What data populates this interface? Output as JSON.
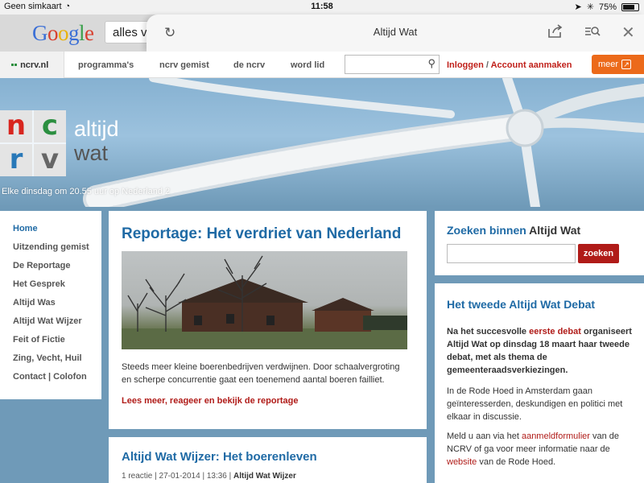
{
  "status": {
    "carrier": "Geen simkaart",
    "time": "11:58",
    "battery": "75%",
    "battery_level": 0.75
  },
  "browser": {
    "search_text": "alles v",
    "page_title": "Altijd Wat"
  },
  "nav": {
    "logo": "ncrv.nl",
    "items": [
      "programma's",
      "ncrv gemist",
      "de ncrv",
      "word lid"
    ],
    "login": "Inloggen",
    "account": "Account aanmaken",
    "meer": "meer"
  },
  "hero": {
    "logo_letters": [
      "n",
      "c",
      "r",
      "v"
    ],
    "title_line1": "altijd",
    "title_line2": "wat",
    "subtitle": "Elke dinsdag om 20.55 uur op Nederland 2"
  },
  "menu": [
    "Home",
    "Uitzending gemist",
    "De Reportage",
    "Het Gesprek",
    "Altijd Was",
    "Altijd Wat Wijzer",
    "Feit of Fictie",
    "Zing, Vecht, Huil",
    "Contact | Colofon"
  ],
  "article1": {
    "title": "Reportage: Het verdriet van Nederland",
    "text": "Steeds meer kleine boerenbedrijven verdwijnen. Door schaalvergroting en scherpe concurrentie gaat een toenemend aantal boeren failliet.",
    "link": "Lees meer, reageer en bekijk de reportage"
  },
  "article2": {
    "title": "Altijd Wat Wijzer: Het boerenleven",
    "meta_prefix": "1 reactie | 27-01-2014 | 13:36 |",
    "meta_category": "Altijd Wat Wijzer"
  },
  "side_search": {
    "head_a": "Zoeken binnen",
    "head_b": "Altijd Wat",
    "button": "zoeken"
  },
  "debat": {
    "title": "Het tweede Altijd Wat Debat",
    "p1_a": "Na het succesvolle ",
    "p1_link": "eerste debat",
    "p1_b": " organiseert Altijd Wat op dinsdag 18 maart haar tweede debat, met als thema de gemeenteraadsverkiezingen.",
    "p2": "In de Rode Hoed in Amsterdam gaan geïnteresserden, deskundigen en politici met elkaar in discussie.",
    "p3_a": "Meld u aan via het ",
    "p3_link1": "aanmeldformulier",
    "p3_b": " van de NCRV of ga voor meer informatie naar de ",
    "p3_link2": "website",
    "p3_c": " van de Rode Hoed."
  },
  "colors": {
    "accent_blue": "#1f6aa5",
    "link_red": "#b01b18",
    "orange": "#ec6a1a",
    "logo_red": "#d8261f",
    "logo_green": "#2b8f40",
    "logo_blue": "#2878b8",
    "logo_grey": "#666666"
  }
}
